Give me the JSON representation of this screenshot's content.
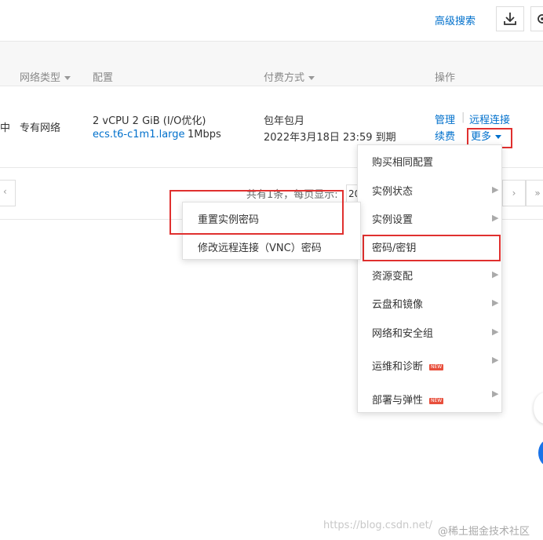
{
  "toolbar": {
    "advanced_search": "高级搜索"
  },
  "table": {
    "headers": {
      "network_type": "网络类型",
      "config": "配置",
      "billing": "付费方式",
      "actions": "操作"
    },
    "row": {
      "status_fragment": "中",
      "network": "专有网络",
      "config_line1": "2 vCPU 2 GiB  (I/O优化)",
      "instance_type": "ecs.t6-c1m1.large",
      "bandwidth": "1Mbps",
      "billing_type": "包年包月",
      "expiry": "2022年3月18日 23:59 到期",
      "actions": {
        "manage": "管理",
        "remote": "远程连接",
        "renew": "续费",
        "more": "更多",
        "separator": "|"
      }
    }
  },
  "pager": {
    "summary": "共有1条，每页显示:",
    "size": "20",
    "prev": "‹",
    "next": "›",
    "last": "»"
  },
  "more_menu": {
    "items": [
      {
        "label": "购买相同配置",
        "has_sub": false,
        "badge": ""
      },
      {
        "label": "实例状态",
        "has_sub": true,
        "badge": ""
      },
      {
        "label": "实例设置",
        "has_sub": true,
        "badge": ""
      },
      {
        "label": "密码/密钥",
        "has_sub": true,
        "badge": ""
      },
      {
        "label": "资源变配",
        "has_sub": true,
        "badge": ""
      },
      {
        "label": "云盘和镜像",
        "has_sub": true,
        "badge": ""
      },
      {
        "label": "网络和安全组",
        "has_sub": true,
        "badge": ""
      },
      {
        "label": "运维和诊断",
        "has_sub": true,
        "badge": "NEW"
      },
      {
        "label": "部署与弹性",
        "has_sub": true,
        "badge": "NEW"
      }
    ]
  },
  "password_submenu": {
    "items": [
      "重置实例密码",
      "修改远程连接（VNC）密码"
    ]
  },
  "watermark": {
    "url": "https://blog.csdn.net/",
    "brand": "@稀土掘金技术社区"
  },
  "colors": {
    "link": "#0070cc",
    "highlight": "#e0302f",
    "badge": "#e84f3c"
  }
}
